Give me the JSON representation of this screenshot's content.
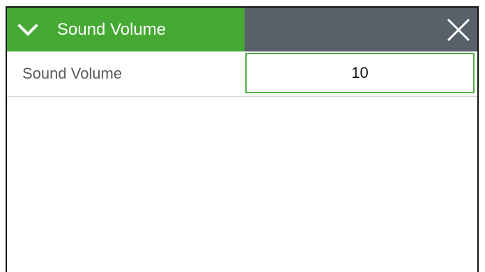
{
  "header": {
    "title": "Sound Volume",
    "accent_color": "#45a933",
    "right_color": "#58616a",
    "collapse_icon": "chevron-down-icon",
    "close_icon": "close-icon"
  },
  "settings": {
    "rows": [
      {
        "label": "Sound Volume",
        "value": "10"
      }
    ]
  }
}
